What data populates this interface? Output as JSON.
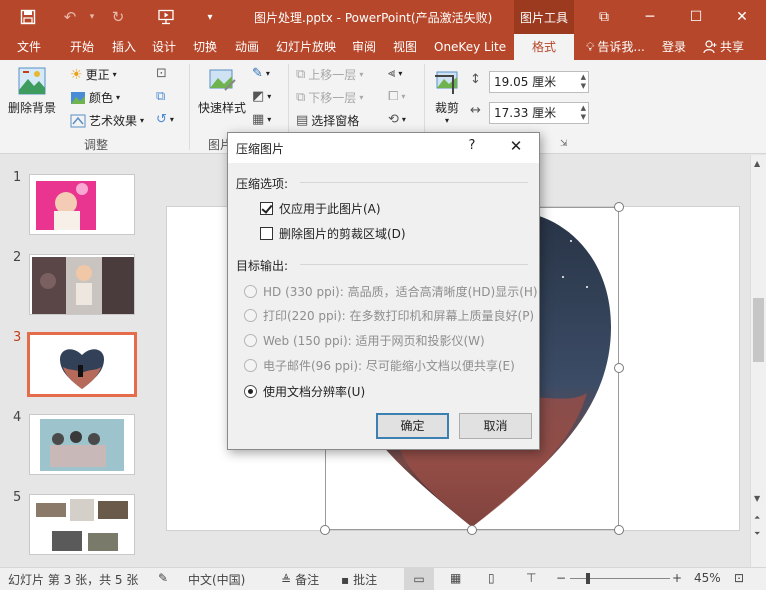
{
  "titlebar": {
    "document_title": "图片处理.pptx - PowerPoint(产品激活失败)",
    "context_group": "图片工具",
    "minimize_glyph": "─",
    "restore_glyph": "☐",
    "close_glyph": "✕",
    "ribbon_display_glyph": "⧉"
  },
  "tabs": [
    "文件",
    "开始",
    "插入",
    "设计",
    "切换",
    "动画",
    "幻灯片放映",
    "审阅",
    "视图",
    "OneKey Lite",
    "格式"
  ],
  "active_tab": "格式",
  "tell_me": "告诉我...",
  "sign_in": "登录",
  "share": "共享",
  "ribbon": {
    "remove_background": "删除背景",
    "corrections": "更正",
    "color": "颜色",
    "artistic_effects": "艺术效果",
    "adjust_group": "调整",
    "quick_styles": "快速样式",
    "styles_group": "图片",
    "bring_forward": "上移一层",
    "send_backward": "下移一层",
    "selection_pane": "选择窗格",
    "crop": "裁剪",
    "height": "19.05 厘米",
    "width": "17.33 厘米"
  },
  "slides": [
    {
      "number": "1"
    },
    {
      "number": "2"
    },
    {
      "number": "3"
    },
    {
      "number": "4"
    },
    {
      "number": "5"
    }
  ],
  "dialog": {
    "title": "压缩图片",
    "help": "?",
    "close": "✕",
    "compression_section": "压缩选项:",
    "apply_only": "仅应用于此图片(A)",
    "apply_only_checked": true,
    "delete_cropped": "删除图片的剪裁区域(D)",
    "delete_cropped_checked": false,
    "target_section": "目标输出:",
    "options": [
      {
        "label": "HD (330 ppi): 高品质，适合高清晰度(HD)显示(H)",
        "enabled": false,
        "selected": false
      },
      {
        "label": "打印(220 ppi): 在多数打印机和屏幕上质量良好(P)",
        "enabled": false,
        "selected": false
      },
      {
        "label": "Web (150 ppi): 适用于网页和投影仪(W)",
        "enabled": false,
        "selected": false
      },
      {
        "label": "电子邮件(96 ppi): 尽可能缩小文档以便共享(E)",
        "enabled": false,
        "selected": false
      },
      {
        "label": "使用文档分辨率(U)",
        "enabled": true,
        "selected": true
      }
    ],
    "ok": "确定",
    "cancel": "取消"
  },
  "statusbar": {
    "slide_info": "幻灯片 第 3 张，共 5 张",
    "language": "中文(中国)",
    "notes": "备注",
    "comments": "批注",
    "zoom": "45%"
  },
  "colors": {
    "accent": "#b7472a",
    "context_tab": "#9c3a20",
    "selected_thumb_border": "#e46c4b"
  }
}
